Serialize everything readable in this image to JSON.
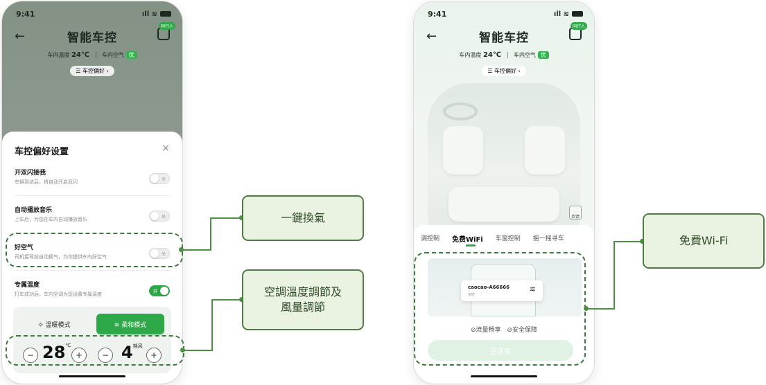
{
  "left_phone": {
    "status_time": "9:41",
    "status_signal": "ıll ≋",
    "nav": {
      "back": "←",
      "title": "智能车控",
      "share_badge": "同行人"
    },
    "climate": {
      "temp_label": "车内温度",
      "temp_value": "24℃",
      "air_label": "车内空气",
      "air_value": "优"
    },
    "pref_button": "☰ 车控偏好 ›",
    "sheet": {
      "title": "车控偏好设置",
      "close": "×",
      "options": [
        {
          "name": "开双闪接我",
          "desc": "车辆到达后，将自动开启双闪",
          "toggle": "关",
          "on": false
        },
        {
          "name": "自动播放音乐",
          "desc": "上车后，为您在车内自动播放音乐",
          "toggle": "关",
          "on": false
        },
        {
          "name": "好空气",
          "desc": "司机接驾前自动换气，为你提供车内好空气",
          "toggle": "关",
          "on": false
        },
        {
          "name": "专属温度",
          "desc": "打车成功后，车内空调为您设置专属温度",
          "toggle": "开",
          "on": true
        }
      ],
      "modes": {
        "warm": "☼ 温暖模式",
        "soft": "≋ 柔和模式",
        "selected": "soft"
      },
      "temperature": {
        "minus": "−",
        "value": "28",
        "unit": "℃",
        "plus": "+"
      },
      "fan": {
        "minus": "−",
        "value": "4",
        "unit": "档风",
        "plus": "+"
      }
    }
  },
  "right_phone": {
    "status_time": "9:41",
    "status_signal": "ıll ≋",
    "nav": {
      "back": "←",
      "title": "智能车控",
      "share_badge": "同行人"
    },
    "climate": {
      "temp_label": "车内温度",
      "temp_value": "24℃",
      "air_label": "车内空气",
      "air_value": "优"
    },
    "pref_button": "☰ 车控偏好 ›",
    "feedback": "反馈",
    "tabs": [
      "调控制",
      "免费WiFi",
      "车窗控制",
      "摇一摇寻车"
    ],
    "active_tab": "免费WiFi",
    "wifi": {
      "ssid": "caocao-A66666",
      "sub": "加密",
      "signal_icon": "≋"
    },
    "features": "⊘流量畅享 ⊘安全保障",
    "connected_button": "已连接"
  },
  "callouts": {
    "air_exchange": "一鍵換氣",
    "climate_control": "空調溫度調節及\n風量調節",
    "free_wifi": "免費Wi-Fi"
  },
  "colors": {
    "accent": "#2fa84a",
    "callout_border": "#4f7a45",
    "callout_fill": "#eaf2e1"
  }
}
